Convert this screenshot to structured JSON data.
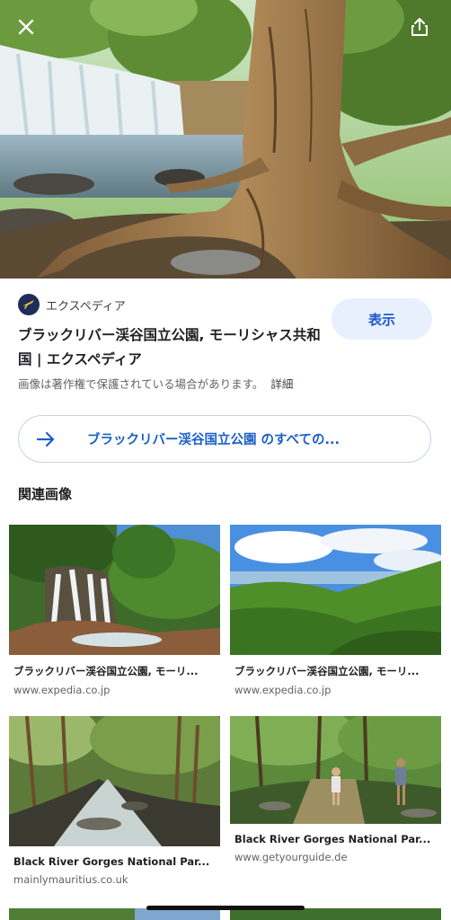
{
  "hero": {
    "close_icon": "close-icon",
    "share_icon": "share-icon"
  },
  "source": {
    "icon": "airplane-icon",
    "name": "エクスペディア"
  },
  "visit_button": "表示",
  "title": "ブラックリバー渓谷国立公園, モーリシャス共和国 | エクスペディア",
  "copyright": {
    "notice": "画像は著作権で保護されている場合があります。",
    "details": "詳細"
  },
  "see_all": {
    "icon": "arrow-right-icon",
    "label": "ブラックリバー渓谷国立公園 のすべての..."
  },
  "related": {
    "heading": "関連画像",
    "items": [
      {
        "title": "ブラックリバー渓谷国立公園, モーリ...",
        "source": "www.expedia.co.jp"
      },
      {
        "title": "ブラックリバー渓谷国立公園, モーリ...",
        "source": "www.expedia.co.jp"
      },
      {
        "title": "Black River Gorges National Par...",
        "source": "mainlymauritius.co.uk"
      },
      {
        "title": "Black River Gorges National Par...",
        "source": "www.getyourguide.de"
      }
    ]
  },
  "colors": {
    "accent": "#1a56c9",
    "visit_bg": "#e8f0fe",
    "pill_border": "#c6d3ea"
  }
}
